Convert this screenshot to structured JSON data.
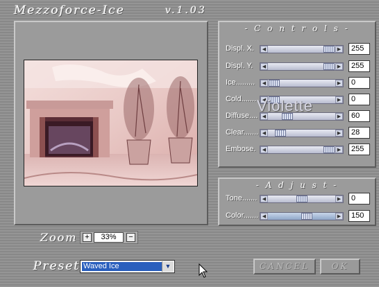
{
  "app": {
    "title": "Mezzoforce-Ice",
    "version": "v.1.03"
  },
  "controls": {
    "title": "- C o n t r o l s -",
    "rows": [
      {
        "label": "Displ. X.",
        "value": "255",
        "position": 1.0
      },
      {
        "label": "Displ. Y.",
        "value": "255",
        "position": 1.0
      },
      {
        "label": "Ice.........",
        "value": "0",
        "position": 0.0
      },
      {
        "label": "Cold.......",
        "value": "0",
        "position": 0.0
      },
      {
        "label": "Diffuse....",
        "value": "60",
        "position": 0.24
      },
      {
        "label": "Clear.......",
        "value": "28",
        "position": 0.11
      },
      {
        "label": "Embose.",
        "value": "255",
        "position": 1.0
      }
    ]
  },
  "adjust": {
    "title": "- A d j u s t -",
    "rows": [
      {
        "label": "Tone.......",
        "value": "0",
        "position": 0.5
      },
      {
        "label": "Color.......",
        "value": "150",
        "position": 0.59
      }
    ]
  },
  "watermark": "Violette",
  "zoom": {
    "label": "Zoom",
    "value": "33%",
    "in_symbol": "+",
    "out_symbol": "−"
  },
  "preset": {
    "label": "Preset",
    "value": "Waved Ice"
  },
  "buttons": {
    "cancel": "CANCEL",
    "ok": "OK"
  },
  "icons": {
    "left_arrow": "◀",
    "right_arrow": "▶",
    "dropdown": "▼"
  },
  "colors": {
    "selection": "#2a5fbd",
    "panel": "#9b9b9b"
  }
}
